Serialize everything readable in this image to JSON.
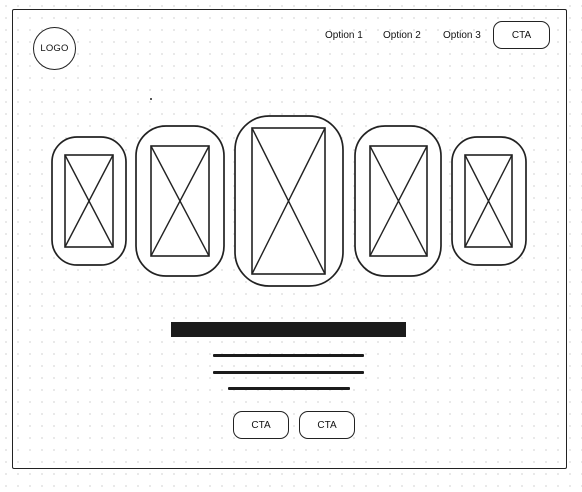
{
  "header": {
    "logo_label": "LOGO",
    "nav_items": [
      "Option 1",
      "Option 2",
      "Option 3"
    ],
    "cta_label": "CTA"
  },
  "carousel": {
    "card_icons": [
      "image-placeholder-icon",
      "image-placeholder-icon",
      "image-placeholder-icon",
      "image-placeholder-icon",
      "image-placeholder-icon"
    ]
  },
  "content": {
    "cta_buttons": [
      "CTA",
      "CTA"
    ]
  }
}
